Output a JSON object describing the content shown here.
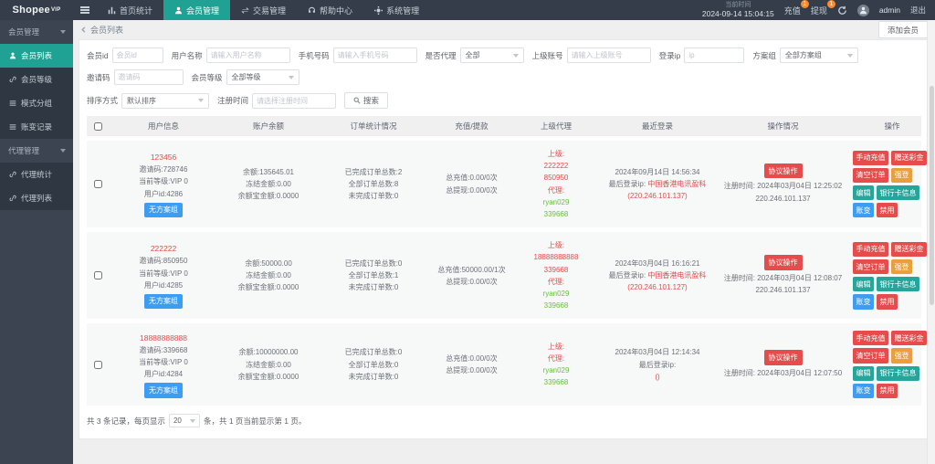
{
  "theme": {
    "topbar_bg": "#343d49",
    "accent_teal": "#1fa294",
    "danger_red": "#e64c4c",
    "warn_orange": "#eb9e3e",
    "info_blue": "#3d9df2",
    "success_green": "#67c23a"
  },
  "topbar": {
    "logo": "Shopee",
    "logo_sup": "VIP",
    "nav": [
      {
        "label": "首页统计",
        "icon": "chart-icon"
      },
      {
        "label": "会员管理",
        "icon": "user-icon"
      },
      {
        "label": "交易管理",
        "icon": "exchange-icon"
      },
      {
        "label": "帮助中心",
        "icon": "headset-icon"
      },
      {
        "label": "系统管理",
        "icon": "gear-icon"
      }
    ],
    "time_label": "当前时间",
    "time_value": "2024-09-14 15:04:15",
    "recharge": {
      "label": "充值",
      "badge": "1"
    },
    "withdraw": {
      "label": "提现",
      "badge": "1"
    },
    "username": "admin",
    "logout": "退出"
  },
  "sidebar": {
    "groups": [
      {
        "label": "会员管理",
        "items": [
          {
            "label": "会员列表",
            "icon": "user-icon"
          },
          {
            "label": "会员等级",
            "icon": "link-icon"
          },
          {
            "label": "模式分组",
            "icon": "list-icon"
          },
          {
            "label": "账变记录",
            "icon": "list-icon"
          }
        ]
      },
      {
        "label": "代理管理",
        "items": [
          {
            "label": "代理统计",
            "icon": "link-icon"
          },
          {
            "label": "代理列表",
            "icon": "link-icon"
          }
        ]
      }
    ]
  },
  "page": {
    "breadcrumb": "会员列表",
    "add_member": "添加会员"
  },
  "filters": {
    "member_id": {
      "label": "会员id",
      "placeholder": "会员id"
    },
    "username": {
      "label": "用户名称",
      "placeholder": "请输入用户名称"
    },
    "phone": {
      "label": "手机号码",
      "placeholder": "请输入手机号码"
    },
    "is_agent": {
      "label": "是否代理",
      "value": "全部"
    },
    "parent": {
      "label": "上级账号",
      "placeholder": "请输入上级账号"
    },
    "login_ip": {
      "label": "登录ip",
      "placeholder": "ip"
    },
    "plan_group": {
      "label": "方案组",
      "value": "全部方案组"
    },
    "invite_code": {
      "label": "邀请码",
      "placeholder": "邀请码"
    },
    "member_level": {
      "label": "会员等级",
      "value": "全部等级"
    },
    "sort": {
      "label": "排序方式",
      "value": "默认排序"
    },
    "reg_time": {
      "label": "注册时间",
      "placeholder": "请选择注册时间"
    },
    "search_label": "搜索"
  },
  "table": {
    "headers": [
      "用户信息",
      "账户余额",
      "订单统计情况",
      "充值/提款",
      "上级代理",
      "最近登录",
      "操作情况",
      "操作"
    ],
    "action_buttons": [
      {
        "label": "手动充值",
        "color": "red",
        "name": "manual-recharge"
      },
      {
        "label": "赠送彩金",
        "color": "red",
        "name": "gift-bonus"
      },
      {
        "label": "清空订单",
        "color": "red",
        "name": "clear-orders"
      },
      {
        "label": "强登",
        "color": "orange",
        "name": "force-login"
      },
      {
        "label": "编辑",
        "color": "teal",
        "name": "edit"
      },
      {
        "label": "银行卡信息",
        "color": "teal",
        "name": "bank-card-info"
      },
      {
        "label": "账变",
        "color": "blue",
        "name": "account-change"
      },
      {
        "label": "禁用",
        "color": "red",
        "name": "disable"
      }
    ],
    "rows": [
      {
        "user": {
          "account": "123456",
          "invite": "邀请码:728746",
          "level": "当前等级:VIP 0",
          "uid": "用户id:4286",
          "badge": "无方案组"
        },
        "balance": {
          "l1": "余额:135645.01",
          "l2": "冻结金额:0.00",
          "l3": "余额宝金额:0.0000"
        },
        "orders": {
          "l1": "已完成订单总数:2",
          "l2": "全部订单总数:8",
          "l3": "未完成订单数:0"
        },
        "charge": {
          "l1": "总充值:0.00/0次",
          "l2": "总提现:0.00/0次"
        },
        "agent": {
          "sup_label": "上级:",
          "sup_account": "222222",
          "sup_code": "850950",
          "agent_label": "代理:",
          "agent_name": "ryan029",
          "agent_code": "339668"
        },
        "login": {
          "time": "2024年09月14日 14:56:34",
          "ip_label": "最后登录ip: ",
          "isp": "中国香港电讯盈科",
          "ip": "(220.246.101.137)"
        },
        "op": {
          "badge": "协议操作",
          "reg": "注册时间: 2024年03月04日 12:25:02",
          "ip": "220.246.101.137"
        }
      },
      {
        "user": {
          "account": "222222",
          "invite": "邀请码:850950",
          "level": "当前等级:VIP 0",
          "uid": "用户id:4285",
          "badge": "无方案组"
        },
        "balance": {
          "l1": "余额:50000.00",
          "l2": "冻结金额:0.00",
          "l3": "余额宝金额:0.0000"
        },
        "orders": {
          "l1": "已完成订单总数:0",
          "l2": "全部订单总数:1",
          "l3": "未完成订单数:0"
        },
        "charge": {
          "l1": "总充值:50000.00/1次",
          "l2": "总提现:0.00/0次"
        },
        "agent": {
          "sup_label": "上级:",
          "sup_account": "18888888888",
          "sup_code": "339668",
          "agent_label": "代理:",
          "agent_name": "ryan029",
          "agent_code": "339668"
        },
        "login": {
          "time": "2024年03月04日 16:16:21",
          "ip_label": "最后登录ip: ",
          "isp": "中国香港电讯盈科",
          "ip": "(220.246.101.127)"
        },
        "op": {
          "badge": "协议操作",
          "reg": "注册时间: 2024年03月04日 12:08:07",
          "ip": "220.246.101.137"
        }
      },
      {
        "user": {
          "account": "18888888888",
          "invite": "邀请码:339668",
          "level": "当前等级:VIP 0",
          "uid": "用户id:4284",
          "badge": "无方案组"
        },
        "balance": {
          "l1": "余额:10000000.00",
          "l2": "冻结金额:0.00",
          "l3": "余额宝金额:0.0000"
        },
        "orders": {
          "l1": "已完成订单总数:0",
          "l2": "全部订单总数:0",
          "l3": "未完成订单数:0"
        },
        "charge": {
          "l1": "总充值:0.00/0次",
          "l2": "总提现:0.00/0次"
        },
        "agent": {
          "sup_label": "上级:",
          "sup_account": "",
          "sup_code": "",
          "agent_label": "代理:",
          "agent_name": "ryan029",
          "agent_code": "339668"
        },
        "login": {
          "time": "2024年03月04日 12:14:34",
          "ip_label": "最后登录ip:",
          "isp": "",
          "ip": "()"
        },
        "op": {
          "badge": "协议操作",
          "reg": "注册时间: 2024年03月04日 12:07:50",
          "ip": ""
        }
      }
    ]
  },
  "pagination": {
    "prefix": "共 3 条记录，每页显示",
    "per_page": "20",
    "suffix": "条，共 1 页当前显示第 1 页。"
  }
}
